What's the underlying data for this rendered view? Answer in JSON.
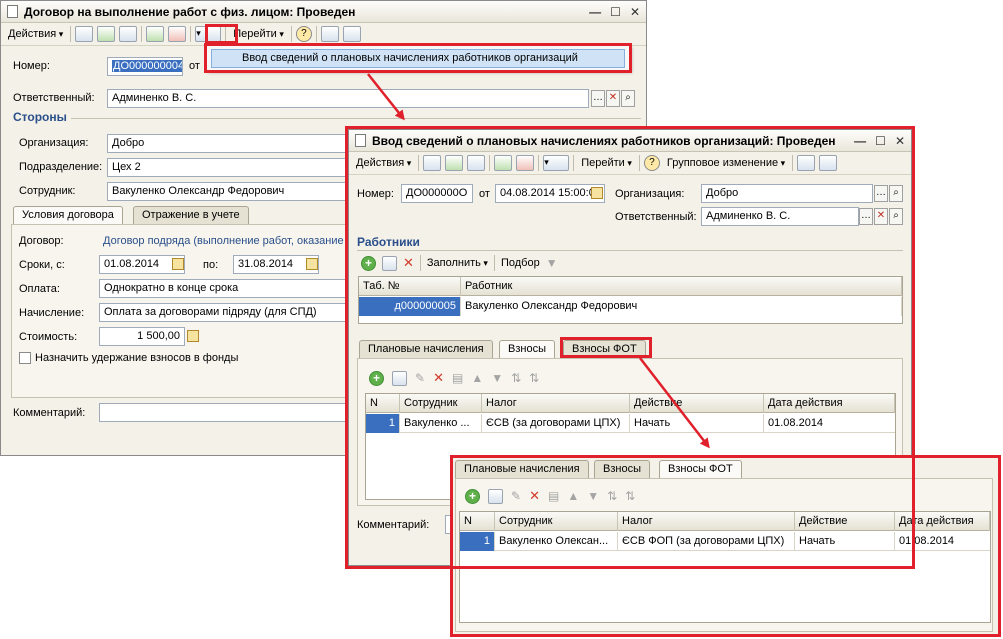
{
  "window1": {
    "title": "Договор на выполнение работ с физ. лицом: Проведен",
    "toolbar": {
      "actions": "Действия",
      "goto": "Перейти"
    },
    "number_label": "Номер:",
    "number_value": "ДО000000004",
    "from_label": "от",
    "responsible_label": "Ответственный:",
    "responsible_value": "Админенко В. С.",
    "parties_section": "Стороны",
    "org_label": "Организация:",
    "org_value": "Добро",
    "dept_label": "Подразделение:",
    "dept_value": "Цех 2",
    "employee_label": "Сотрудник:",
    "employee_value": "Вакуленко Олександр Федорович",
    "tabs": [
      "Условия договора",
      "Отражение в учете"
    ],
    "contract_label": "Договор:",
    "contract_value": "Договор подряда (выполнение работ, оказание",
    "dates_label": "Сроки, с:",
    "date_from": "01.08.2014",
    "to_label": "по:",
    "date_to": "31.08.2014",
    "payment_label": "Оплата:",
    "payment_value": "Однократно в конце срока",
    "accrual_label": "Начисление:",
    "accrual_value": "Оплата за договорами підряду (для СПД)",
    "cost_label": "Стоимость:",
    "cost_value": "1 500,00",
    "withhold_label": "Назначить удержание взносов в фонды",
    "comment_label": "Комментарий:"
  },
  "popup_menu": {
    "item": "Ввод сведений о плановых начислениях работников организаций"
  },
  "window2": {
    "title": "Ввод сведений о плановых начислениях работников организаций: Проведен",
    "toolbar": {
      "actions": "Действия",
      "goto": "Перейти",
      "group_change": "Групповое изменение"
    },
    "number_label": "Номер:",
    "number_value": "ДО000000О",
    "from_label": "от",
    "date_value": "04.08.2014 15:00:0",
    "org_label": "Организация:",
    "org_value": "Добро",
    "responsible_label": "Ответственный:",
    "responsible_value": "Админенко В. С.",
    "workers_section": "Работники",
    "fill_label": "Заполнить",
    "select_label": "Подбор",
    "grid_headers": [
      "Таб. №",
      "Работник"
    ],
    "grid_row": {
      "tab_no": "д000000005",
      "worker": "Вакуленко Олександр Федорович"
    },
    "tabs": [
      "Плановые начисления",
      "Взносы",
      "Взносы ФОТ"
    ],
    "contrib_headers": [
      "N",
      "Сотрудник",
      "Налог",
      "Действие",
      "Дата действия"
    ],
    "contrib_row": {
      "n": "1",
      "employee": "Вакуленко ...",
      "tax": "ЄСВ (за договорами ЦПХ)",
      "action": "Начать",
      "date": "01.08.2014"
    },
    "comment_label": "Комментарий:"
  },
  "window3": {
    "tabs": [
      "Плановые начисления",
      "Взносы",
      "Взносы ФОТ"
    ],
    "headers": [
      "N",
      "Сотрудник",
      "Налог",
      "Действие",
      "Дата действия"
    ],
    "row": {
      "n": "1",
      "employee": "Вакуленко Олексан...",
      "tax": "ЄСВ ФОП (за договорами ЦПХ)",
      "action": "Начать",
      "date": "01.08.2014"
    }
  },
  "colors": {
    "highlight": "#e0202a",
    "selection": "#3a6fc0",
    "section": "#2a4f8a"
  }
}
